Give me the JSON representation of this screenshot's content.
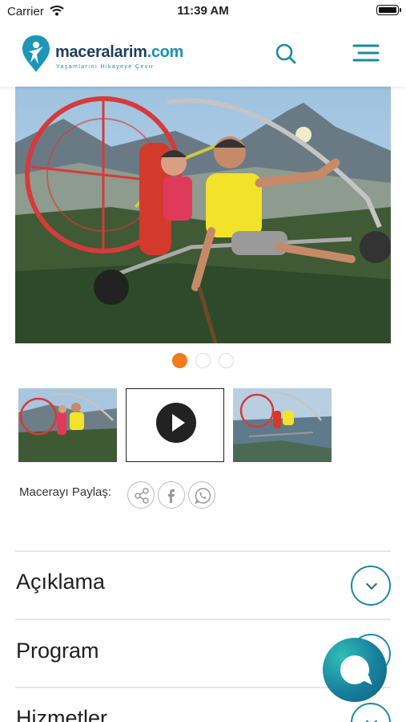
{
  "status_bar": {
    "carrier": "Carrier",
    "time": "11:39 AM",
    "wifi_icon": "wifi-icon",
    "battery_icon": "battery-icon"
  },
  "header": {
    "logo_brand": "maceralarim",
    "logo_tld": ".com",
    "logo_tagline": "Yaşamlarını Hikayeye Çevir",
    "search_icon": "search-icon",
    "menu_icon": "hamburger-menu-icon",
    "accent_color": "#1790b8"
  },
  "gallery": {
    "slide_count": 3,
    "active_slide": 1,
    "active_dot_color": "#f07b1b",
    "thumbnails": [
      "photo",
      "video",
      "photo"
    ]
  },
  "share": {
    "label": "Macerayı Paylaş:",
    "buttons": [
      "share-icon",
      "facebook-icon",
      "whatsapp-icon"
    ]
  },
  "sections": [
    {
      "title": "Açıklama"
    },
    {
      "title": "Program"
    },
    {
      "title": "Hizmetler"
    }
  ],
  "chat_button": {
    "icon": "chat-bubble-icon"
  }
}
